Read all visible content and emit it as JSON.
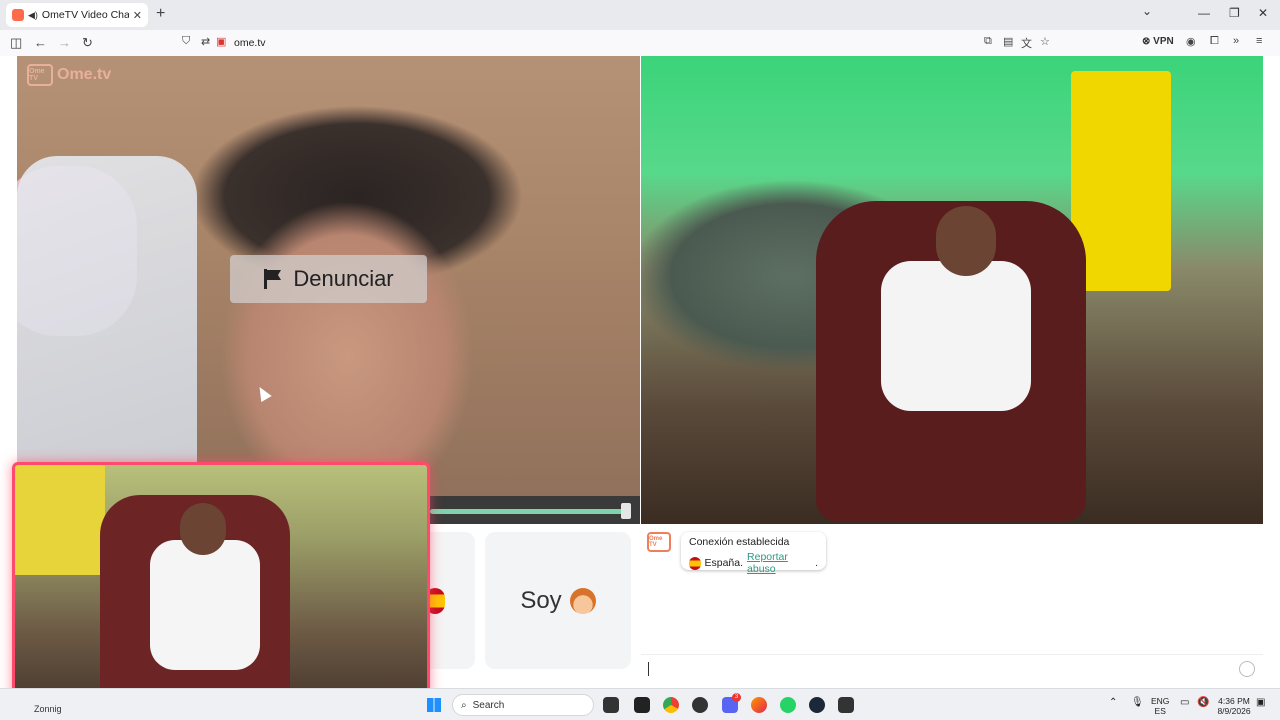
{
  "browser": {
    "tab_title": "OmeTV Video Chat — Ome",
    "tab_close": "✕",
    "new_tab": "+",
    "url": "ome.tv",
    "vpn_label": "VPN",
    "window_controls": {
      "chevron": "⌄",
      "minimize": "—",
      "restore": "❐",
      "close": "✕"
    }
  },
  "page": {
    "logo_text": "Ome.tv",
    "logo_box": "Ome TV",
    "report_button": "Denunciar",
    "report_icon": "flag-icon",
    "gender_label": "Soy",
    "chat": {
      "avatar": "Ome TV",
      "status": "Conexión establecida",
      "country": "España.",
      "report_link": "Reportar abuso",
      "report_link_suffix": "."
    }
  },
  "taskbar": {
    "weather": "Zonnig",
    "search_placeholder": "Search",
    "lang_top": "ENG",
    "lang_bottom": "ES",
    "time": "4:36 PM",
    "date": "8/9/2026",
    "badge_count": "3"
  },
  "colors": {
    "accent": "#2b9a86",
    "cam_border": "#ff4a6b",
    "slider": "#7ed2ad"
  }
}
